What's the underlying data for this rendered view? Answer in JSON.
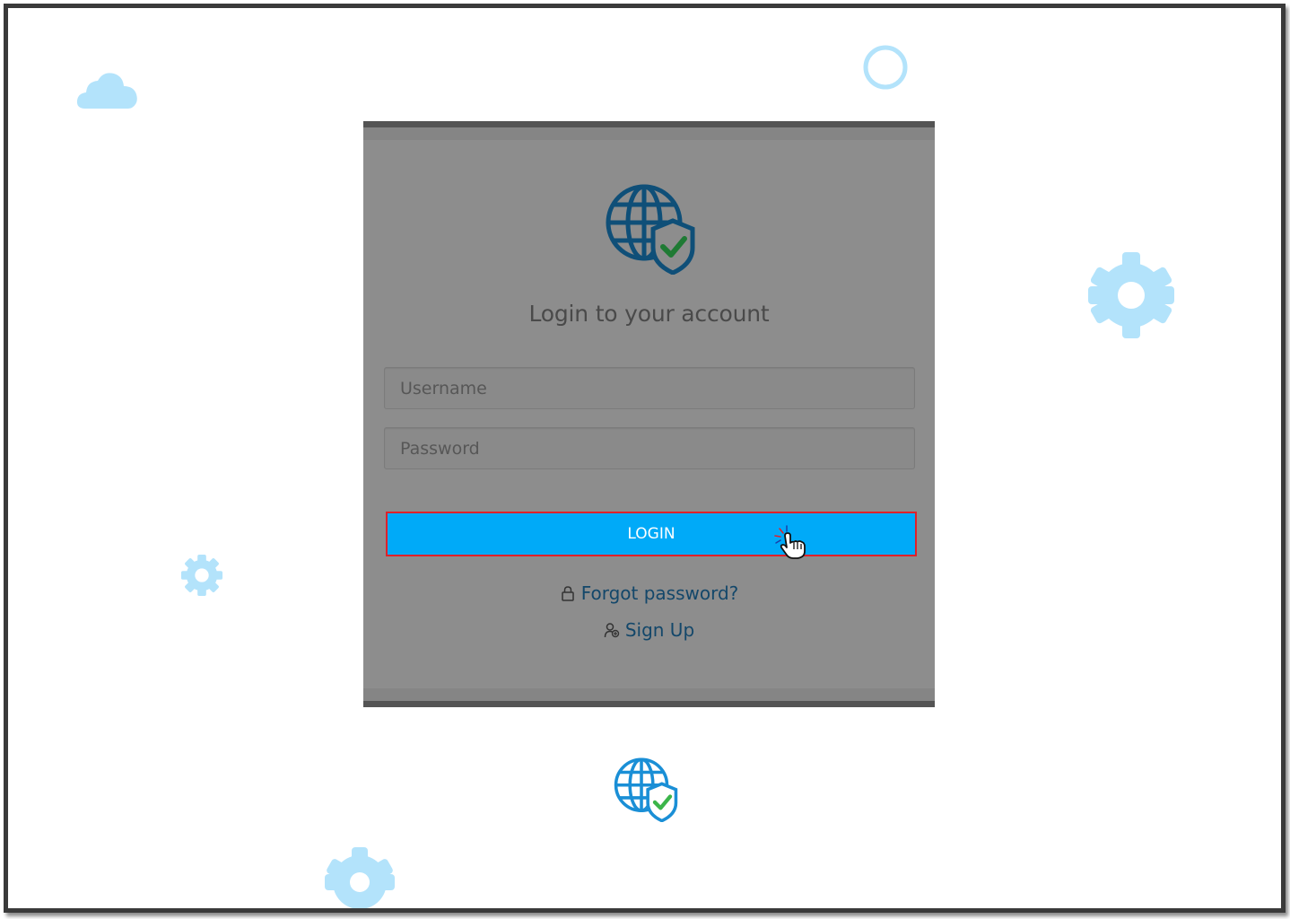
{
  "login": {
    "title": "Login to your account",
    "username_placeholder": "Username",
    "password_placeholder": "Password",
    "login_label": "LOGIN",
    "forgot_label": "Forgot password?",
    "signup_label": "Sign Up"
  },
  "icons": {
    "logo": "globe-shield-check-icon",
    "forgot": "lock-icon",
    "signup": "user-icon",
    "cursor": "hand-pointer-icon",
    "decor": [
      "cloud-icon",
      "circle-icon",
      "gear-icon",
      "gear-icon",
      "globe-shield-check-icon",
      "gear-icon"
    ]
  },
  "colors": {
    "accent_button": "#00aaf8",
    "highlight_border": "#e0212a",
    "decor_light_blue": "#b3e3fb",
    "link": "#13476a"
  }
}
